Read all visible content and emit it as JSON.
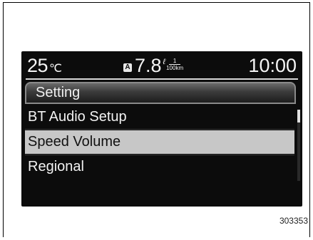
{
  "status_bar": {
    "temperature": "25",
    "temperature_unit": "℃",
    "fuel_badge": "A",
    "fuel_economy": "7.8",
    "fuel_unit_liters": "ℓ",
    "fuel_unit_numerator": "1",
    "fuel_unit_denominator": "100km",
    "clock": "10:00"
  },
  "menu": {
    "title": "Setting",
    "items": [
      {
        "label": "BT Audio Setup",
        "selected": false
      },
      {
        "label": "Speed Volume",
        "selected": true
      },
      {
        "label": "Regional",
        "selected": false
      }
    ],
    "scroll_position": 0.0
  },
  "figure_number": "303353"
}
